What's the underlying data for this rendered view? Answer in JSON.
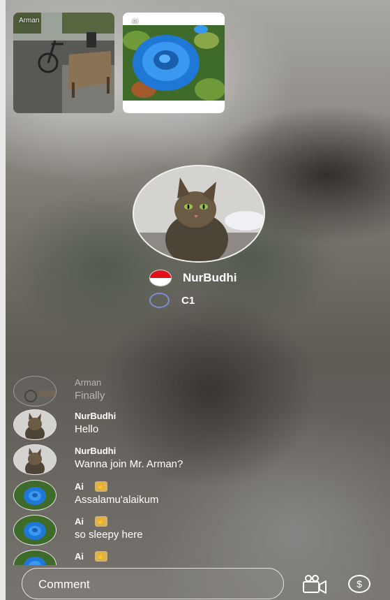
{
  "participants": [
    {
      "name": "Arman"
    },
    {
      "name": "Ai"
    }
  ],
  "host": {
    "name": "NurBudhi",
    "level": "C1",
    "flag": "indonesia-flag-icon"
  },
  "chat": [
    {
      "name": "Arman",
      "message": "Finally",
      "badge": false
    },
    {
      "name": "NurBudhi",
      "message": "Hello",
      "badge": false
    },
    {
      "name": "NurBudhi",
      "message": "Wanna join Mr. Arman?",
      "badge": false
    },
    {
      "name": "Ai",
      "message": "Assalamu'alaikum",
      "badge": true
    },
    {
      "name": "Ai",
      "message": "so sleepy here",
      "badge": true
    },
    {
      "name": "Ai",
      "message": "",
      "badge": true
    }
  ],
  "composer": {
    "placeholder": "Comment",
    "camera_icon": "video-camera-icon",
    "gift_icon": "coin-icon"
  },
  "colors": {
    "level_ring": "#7d8ed8",
    "badge": "#d9b25a",
    "flag_red": "#e3101b"
  }
}
